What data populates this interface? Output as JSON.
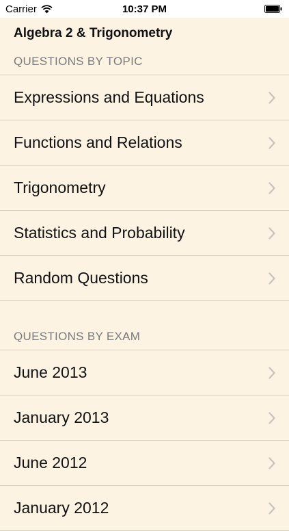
{
  "status_bar": {
    "carrier": "Carrier",
    "time": "10:37 PM"
  },
  "header": {
    "title": "Algebra 2 & Trigonometry"
  },
  "sections": [
    {
      "header": "QUESTIONS BY TOPIC",
      "items": [
        {
          "label": "Expressions and Equations"
        },
        {
          "label": "Functions and Relations"
        },
        {
          "label": "Trigonometry"
        },
        {
          "label": "Statistics and Probability"
        },
        {
          "label": "Random Questions"
        }
      ]
    },
    {
      "header": "QUESTIONS BY EXAM",
      "items": [
        {
          "label": "June 2013"
        },
        {
          "label": "January 2013"
        },
        {
          "label": "June 2012"
        },
        {
          "label": "January 2012"
        }
      ]
    }
  ],
  "colors": {
    "background": "#fdf3e3",
    "separator": "#d6d0c6",
    "section_header": "#7a7a7a",
    "chevron": "#c7c2bb"
  },
  "icons": {
    "wifi": "wifi-icon",
    "battery": "battery-icon",
    "chevron": "chevron-right-icon"
  }
}
